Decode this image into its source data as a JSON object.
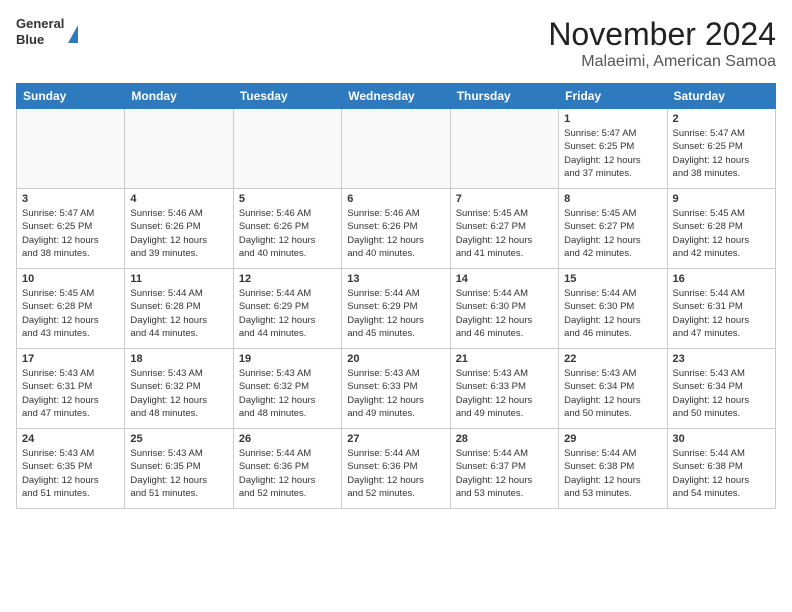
{
  "header": {
    "logo_line1": "General",
    "logo_line2": "Blue",
    "title": "November 2024",
    "subtitle": "Malaeimi, American Samoa"
  },
  "weekdays": [
    "Sunday",
    "Monday",
    "Tuesday",
    "Wednesday",
    "Thursday",
    "Friday",
    "Saturday"
  ],
  "weeks": [
    [
      {
        "day": "",
        "sunrise": "",
        "sunset": "",
        "daylight": ""
      },
      {
        "day": "",
        "sunrise": "",
        "sunset": "",
        "daylight": ""
      },
      {
        "day": "",
        "sunrise": "",
        "sunset": "",
        "daylight": ""
      },
      {
        "day": "",
        "sunrise": "",
        "sunset": "",
        "daylight": ""
      },
      {
        "day": "",
        "sunrise": "",
        "sunset": "",
        "daylight": ""
      },
      {
        "day": "1",
        "sunrise": "Sunrise: 5:47 AM",
        "sunset": "Sunset: 6:25 PM",
        "daylight": "Daylight: 12 hours and 37 minutes."
      },
      {
        "day": "2",
        "sunrise": "Sunrise: 5:47 AM",
        "sunset": "Sunset: 6:25 PM",
        "daylight": "Daylight: 12 hours and 38 minutes."
      }
    ],
    [
      {
        "day": "3",
        "sunrise": "Sunrise: 5:47 AM",
        "sunset": "Sunset: 6:25 PM",
        "daylight": "Daylight: 12 hours and 38 minutes."
      },
      {
        "day": "4",
        "sunrise": "Sunrise: 5:46 AM",
        "sunset": "Sunset: 6:26 PM",
        "daylight": "Daylight: 12 hours and 39 minutes."
      },
      {
        "day": "5",
        "sunrise": "Sunrise: 5:46 AM",
        "sunset": "Sunset: 6:26 PM",
        "daylight": "Daylight: 12 hours and 40 minutes."
      },
      {
        "day": "6",
        "sunrise": "Sunrise: 5:46 AM",
        "sunset": "Sunset: 6:26 PM",
        "daylight": "Daylight: 12 hours and 40 minutes."
      },
      {
        "day": "7",
        "sunrise": "Sunrise: 5:45 AM",
        "sunset": "Sunset: 6:27 PM",
        "daylight": "Daylight: 12 hours and 41 minutes."
      },
      {
        "day": "8",
        "sunrise": "Sunrise: 5:45 AM",
        "sunset": "Sunset: 6:27 PM",
        "daylight": "Daylight: 12 hours and 42 minutes."
      },
      {
        "day": "9",
        "sunrise": "Sunrise: 5:45 AM",
        "sunset": "Sunset: 6:28 PM",
        "daylight": "Daylight: 12 hours and 42 minutes."
      }
    ],
    [
      {
        "day": "10",
        "sunrise": "Sunrise: 5:45 AM",
        "sunset": "Sunset: 6:28 PM",
        "daylight": "Daylight: 12 hours and 43 minutes."
      },
      {
        "day": "11",
        "sunrise": "Sunrise: 5:44 AM",
        "sunset": "Sunset: 6:28 PM",
        "daylight": "Daylight: 12 hours and 44 minutes."
      },
      {
        "day": "12",
        "sunrise": "Sunrise: 5:44 AM",
        "sunset": "Sunset: 6:29 PM",
        "daylight": "Daylight: 12 hours and 44 minutes."
      },
      {
        "day": "13",
        "sunrise": "Sunrise: 5:44 AM",
        "sunset": "Sunset: 6:29 PM",
        "daylight": "Daylight: 12 hours and 45 minutes."
      },
      {
        "day": "14",
        "sunrise": "Sunrise: 5:44 AM",
        "sunset": "Sunset: 6:30 PM",
        "daylight": "Daylight: 12 hours and 46 minutes."
      },
      {
        "day": "15",
        "sunrise": "Sunrise: 5:44 AM",
        "sunset": "Sunset: 6:30 PM",
        "daylight": "Daylight: 12 hours and 46 minutes."
      },
      {
        "day": "16",
        "sunrise": "Sunrise: 5:44 AM",
        "sunset": "Sunset: 6:31 PM",
        "daylight": "Daylight: 12 hours and 47 minutes."
      }
    ],
    [
      {
        "day": "17",
        "sunrise": "Sunrise: 5:43 AM",
        "sunset": "Sunset: 6:31 PM",
        "daylight": "Daylight: 12 hours and 47 minutes."
      },
      {
        "day": "18",
        "sunrise": "Sunrise: 5:43 AM",
        "sunset": "Sunset: 6:32 PM",
        "daylight": "Daylight: 12 hours and 48 minutes."
      },
      {
        "day": "19",
        "sunrise": "Sunrise: 5:43 AM",
        "sunset": "Sunset: 6:32 PM",
        "daylight": "Daylight: 12 hours and 48 minutes."
      },
      {
        "day": "20",
        "sunrise": "Sunrise: 5:43 AM",
        "sunset": "Sunset: 6:33 PM",
        "daylight": "Daylight: 12 hours and 49 minutes."
      },
      {
        "day": "21",
        "sunrise": "Sunrise: 5:43 AM",
        "sunset": "Sunset: 6:33 PM",
        "daylight": "Daylight: 12 hours and 49 minutes."
      },
      {
        "day": "22",
        "sunrise": "Sunrise: 5:43 AM",
        "sunset": "Sunset: 6:34 PM",
        "daylight": "Daylight: 12 hours and 50 minutes."
      },
      {
        "day": "23",
        "sunrise": "Sunrise: 5:43 AM",
        "sunset": "Sunset: 6:34 PM",
        "daylight": "Daylight: 12 hours and 50 minutes."
      }
    ],
    [
      {
        "day": "24",
        "sunrise": "Sunrise: 5:43 AM",
        "sunset": "Sunset: 6:35 PM",
        "daylight": "Daylight: 12 hours and 51 minutes."
      },
      {
        "day": "25",
        "sunrise": "Sunrise: 5:43 AM",
        "sunset": "Sunset: 6:35 PM",
        "daylight": "Daylight: 12 hours and 51 minutes."
      },
      {
        "day": "26",
        "sunrise": "Sunrise: 5:44 AM",
        "sunset": "Sunset: 6:36 PM",
        "daylight": "Daylight: 12 hours and 52 minutes."
      },
      {
        "day": "27",
        "sunrise": "Sunrise: 5:44 AM",
        "sunset": "Sunset: 6:36 PM",
        "daylight": "Daylight: 12 hours and 52 minutes."
      },
      {
        "day": "28",
        "sunrise": "Sunrise: 5:44 AM",
        "sunset": "Sunset: 6:37 PM",
        "daylight": "Daylight: 12 hours and 53 minutes."
      },
      {
        "day": "29",
        "sunrise": "Sunrise: 5:44 AM",
        "sunset": "Sunset: 6:38 PM",
        "daylight": "Daylight: 12 hours and 53 minutes."
      },
      {
        "day": "30",
        "sunrise": "Sunrise: 5:44 AM",
        "sunset": "Sunset: 6:38 PM",
        "daylight": "Daylight: 12 hours and 54 minutes."
      }
    ]
  ]
}
